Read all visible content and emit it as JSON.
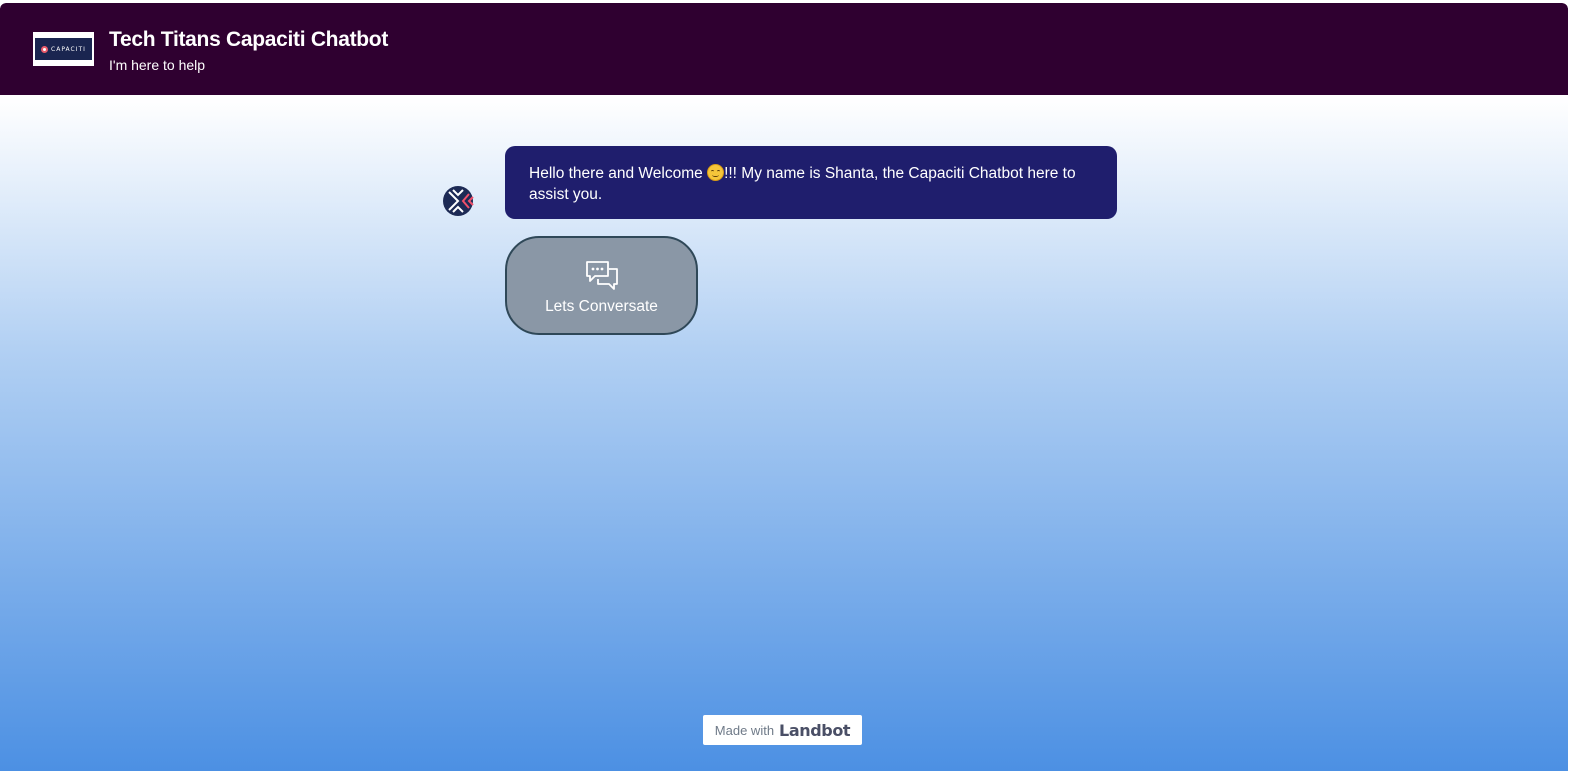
{
  "header": {
    "logo_text": "CAPACITI",
    "title": "Tech Titans Capaciti Chatbot",
    "subtitle": "I'm here to help"
  },
  "chat": {
    "bot_message_before_emoji": "Hello there and Welcome ",
    "bot_message_after_emoji": "!!! My name is Shanta, the Capaciti Chatbot here to assist you.",
    "choice_label": "Lets Conversate"
  },
  "footer": {
    "made_with": "Made with",
    "brand": "Landbot"
  },
  "colors": {
    "header_bg": "#2f0030",
    "bubble_bg": "#1f1e6d",
    "choice_bg": "#8a97a6",
    "choice_border": "#2f4858",
    "gradient_bottom": "#4c90e3"
  },
  "icons": {
    "bot_avatar": "capaciti-logo-icon",
    "choice_icon": "chat-bubbles-icon",
    "emoji": "smiling-face-emoji-icon"
  }
}
